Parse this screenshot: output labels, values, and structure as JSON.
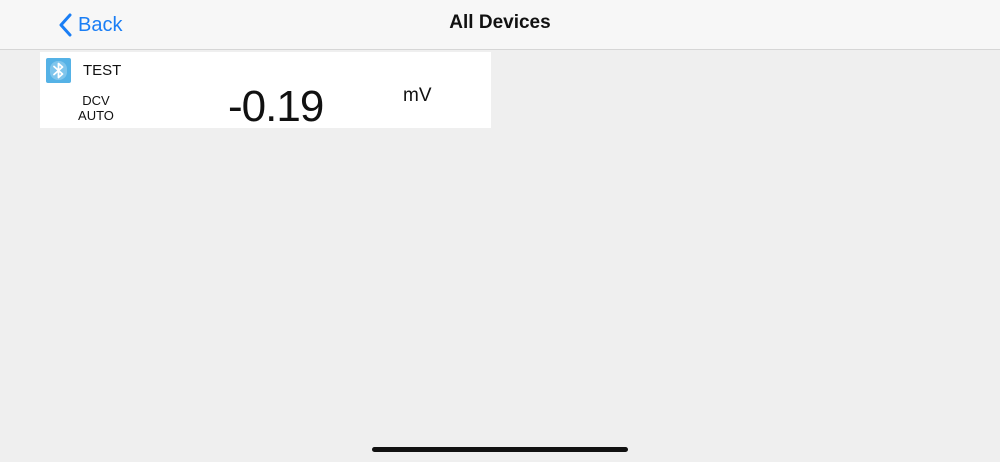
{
  "nav": {
    "back_label": "Back",
    "title": "All Devices"
  },
  "device": {
    "icon": "bluetooth-icon",
    "name": "TEST",
    "mode": "DCV",
    "range": "AUTO",
    "reading": "-0.19",
    "unit": "mV"
  },
  "colors": {
    "accent": "#1a7ef5",
    "bluetooth_badge": "#55b2e6",
    "background": "#efefef",
    "card": "#ffffff"
  }
}
